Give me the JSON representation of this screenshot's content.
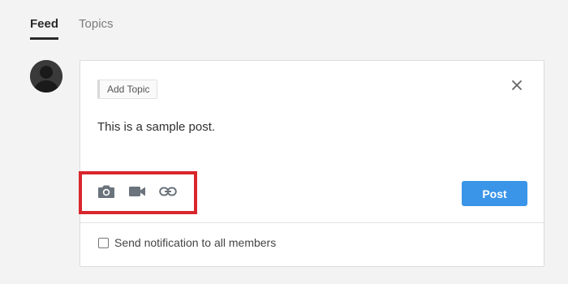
{
  "tabs": [
    {
      "label": "Feed",
      "active": true
    },
    {
      "label": "Topics",
      "active": false
    }
  ],
  "composer": {
    "add_topic_label": "Add Topic",
    "post_text": "This is a sample post.",
    "post_button_label": "Post",
    "notification_label": "Send notification to all members",
    "notification_checked": false,
    "toolbar_icons": [
      "camera-icon",
      "video-icon",
      "link-icon"
    ],
    "close_icon": "close-icon"
  },
  "colors": {
    "accent": "#3a95e8",
    "highlight": "#d9262c",
    "background": "#f3f3f3"
  }
}
